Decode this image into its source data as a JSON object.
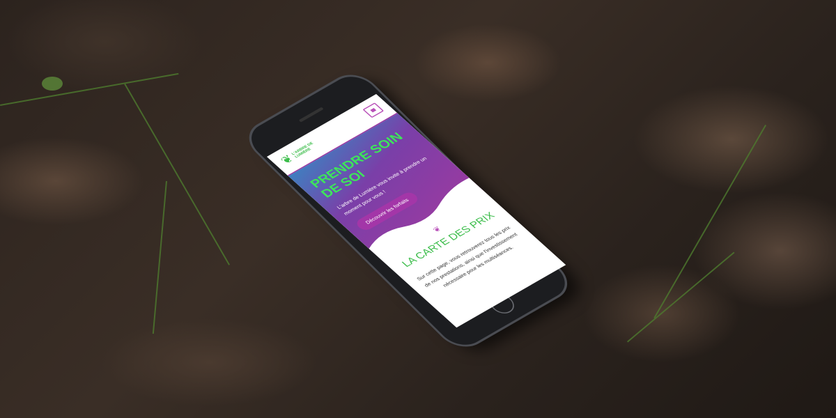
{
  "site": {
    "logo_text": "L'ARBRE DE LUMIÈRE",
    "logo_icon": "butterfly-leaf-icon",
    "menu_icon": "hamburger-menu-icon",
    "hero_title": "PRENDRE SOIN DE SOI",
    "hero_text": "L'arbre de Lumière vous invite à prendre un moment pour vous !",
    "cta_label": "Découvrir les forfaits",
    "section_title": "LA CARTE DES PRIX",
    "section_text": "Sur cette page, vous retrouverez tous les prix de nos prestations, ainsi que l'investissement nécessaire pour les multiséances."
  },
  "colors": {
    "accent_green": "#3bbd4a",
    "accent_purple": "#a336a8"
  }
}
